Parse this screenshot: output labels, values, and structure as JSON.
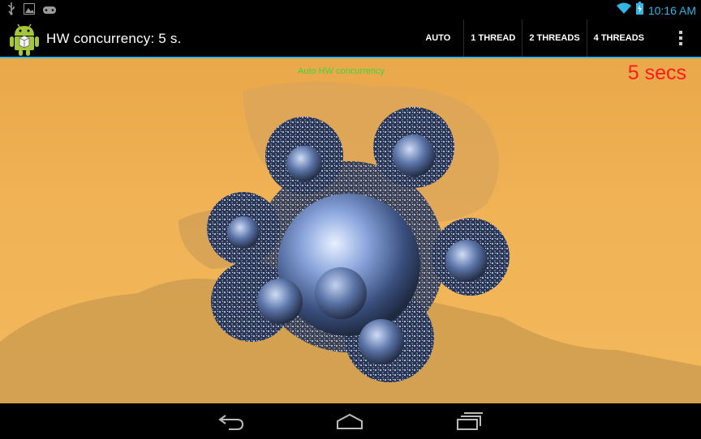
{
  "status_bar": {
    "time": "10:16 AM",
    "icons": [
      "usb-icon",
      "image-icon",
      "gamepad-icon",
      "wifi-icon",
      "battery-icon"
    ]
  },
  "action_bar": {
    "title": "HW concurrency: 5 s.",
    "actions": [
      "AUTO",
      "1 THREAD",
      "2 THREADS",
      "4 THREADS"
    ],
    "overflow_icon": "more-vert-icon"
  },
  "render": {
    "overlay_label": "Auto HW concurrency",
    "elapsed": "5 secs"
  },
  "nav_bar": {
    "icons": [
      "back-icon",
      "home-icon",
      "recents-icon"
    ]
  },
  "colors": {
    "accent": "#33b5e5",
    "elapsed_text": "#ff1b1b",
    "overlay_text": "#3fd43f",
    "background_sand": "#f0b356"
  }
}
